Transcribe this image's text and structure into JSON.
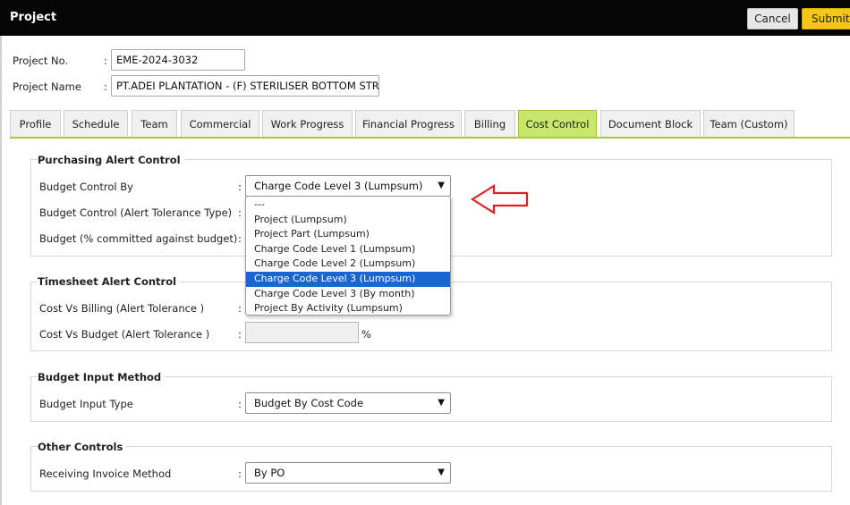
{
  "header": {
    "title": "Project",
    "cancel_label": "Cancel",
    "submit_label": "Submit"
  },
  "project": {
    "no_label": "Project No.",
    "no_value": "EME-2024-3032",
    "name_label": "Project Name",
    "name_value": "PT.ADEI PLANTATION - (F) STERILISER BOTTOM STRAINER"
  },
  "tabs": [
    "Profile",
    "Schedule",
    "Team",
    "Commercial",
    "Work Progress",
    "Financial Progress",
    "Billing",
    "Cost Control",
    "Document Block",
    "Team (Custom)"
  ],
  "active_tab": "Cost Control",
  "purchasing": {
    "title": "Purchasing Alert Control",
    "budget_control_by_label": "Budget Control By",
    "budget_control_by_value": "Charge Code Level 3 (Lumpsum)",
    "alert_tolerance_type_label": "Budget Control (Alert Tolerance Type)",
    "budget_pct_label": "Budget (% committed against budget)"
  },
  "dropdown_options": [
    "---",
    "Project (Lumpsum)",
    "Project Part (Lumpsum)",
    "Charge Code Level 1 (Lumpsum)",
    "Charge Code Level 2 (Lumpsum)",
    "Charge Code Level 3 (Lumpsum)",
    "Charge Code Level 3 (By month)",
    "Project By Activity (Lumpsum)"
  ],
  "dropdown_selected": "Charge Code Level 3 (Lumpsum)",
  "timesheet": {
    "title": "Timesheet Alert Control",
    "cost_vs_billing_label": "Cost Vs Billing (Alert Tolerance )",
    "cost_vs_budget_label": "Cost Vs Budget (Alert Tolerance )",
    "percent_symbol": "%"
  },
  "budget_input": {
    "title": "Budget Input Method",
    "type_label": "Budget Input Type",
    "type_value": "Budget By Cost Code"
  },
  "other": {
    "title": "Other Controls",
    "receiving_label": "Receiving Invoice Method",
    "receiving_value": "By PO"
  },
  "colors": {
    "accent_tab": "#c7e66b",
    "submit": "#f5c518",
    "arrow": "#d9232a",
    "selected_option": "#1a66d0"
  },
  "colon": ":"
}
